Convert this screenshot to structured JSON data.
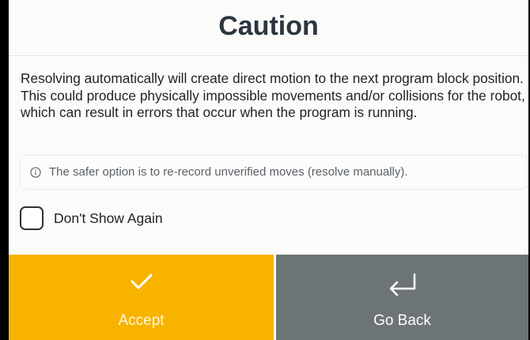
{
  "dialog": {
    "title": "Caution",
    "message": "Resolving automatically will create direct motion to the next program block position. This could produce physically impossible movements and/or collisions for the robot, which can result in errors that occur when the program is running.",
    "info": {
      "icon": "info-circle-icon",
      "text": "The safer option is to re-record unverified moves (resolve manually)."
    },
    "checkbox": {
      "label": "Don't Show Again",
      "checked": false
    },
    "buttons": {
      "accept": {
        "label": "Accept",
        "icon": "checkmark-icon",
        "color": "#f7b300"
      },
      "back": {
        "label": "Go Back",
        "icon": "return-arrow-icon",
        "color": "#6d7475"
      }
    }
  }
}
